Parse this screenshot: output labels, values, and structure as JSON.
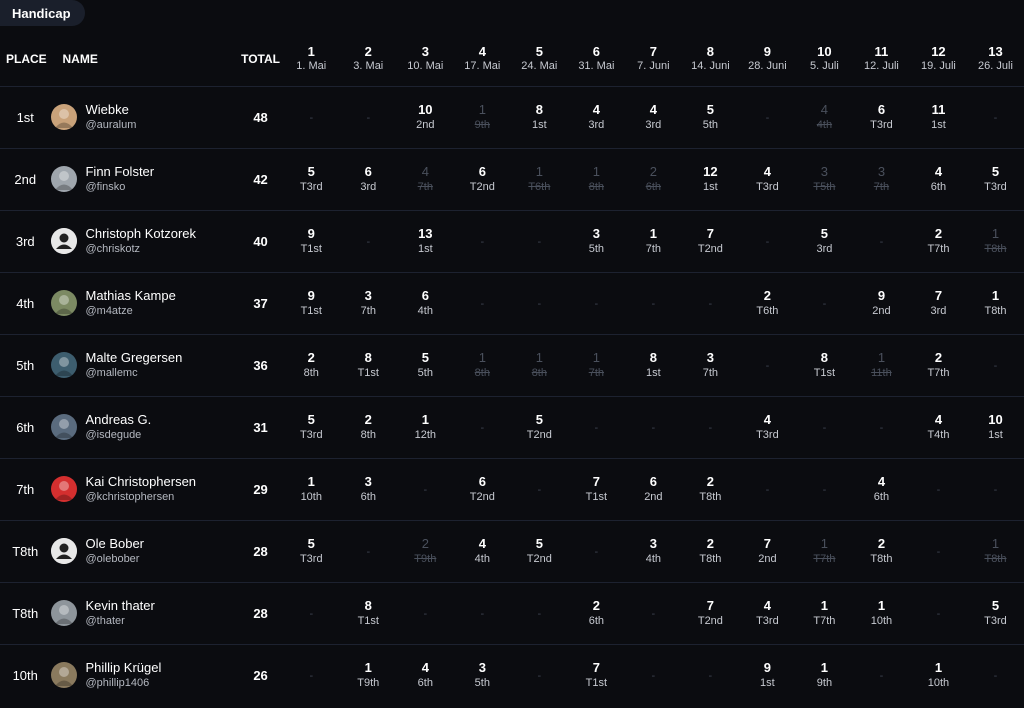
{
  "tab_label": "Handicap",
  "headers": {
    "place": "PLACE",
    "name": "NAME",
    "total": "TOTAL"
  },
  "events": [
    {
      "num": "1",
      "date": "1. Mai"
    },
    {
      "num": "2",
      "date": "3. Mai"
    },
    {
      "num": "3",
      "date": "10. Mai"
    },
    {
      "num": "4",
      "date": "17. Mai"
    },
    {
      "num": "5",
      "date": "24. Mai"
    },
    {
      "num": "6",
      "date": "31. Mai"
    },
    {
      "num": "7",
      "date": "7. Juni"
    },
    {
      "num": "8",
      "date": "14. Juni"
    },
    {
      "num": "9",
      "date": "28. Juni"
    },
    {
      "num": "10",
      "date": "5. Juli"
    },
    {
      "num": "11",
      "date": "12. Juli"
    },
    {
      "num": "12",
      "date": "19. Juli"
    },
    {
      "num": "13",
      "date": "26. Juli"
    }
  ],
  "dash": "-",
  "colors": {
    "background": "#0b0c10",
    "tab_bg": "#1a1f2b",
    "dropped": "#4a505c",
    "divider": "#1d2230"
  },
  "rows": [
    {
      "place": "1st",
      "name": "Wiebke",
      "handle": "@auralum",
      "total": "48",
      "avatar_icon": "avatar-photo-icon",
      "avatar_color": "#c9a27a",
      "results": [
        null,
        null,
        {
          "p": "10",
          "r": "2nd"
        },
        {
          "p": "1",
          "r": "9th",
          "d": true
        },
        {
          "p": "8",
          "r": "1st"
        },
        {
          "p": "4",
          "r": "3rd"
        },
        {
          "p": "4",
          "r": "3rd"
        },
        {
          "p": "5",
          "r": "5th"
        },
        null,
        {
          "p": "4",
          "r": "4th",
          "d": true
        },
        {
          "p": "6",
          "r": "T3rd"
        },
        {
          "p": "11",
          "r": "1st"
        },
        null
      ]
    },
    {
      "place": "2nd",
      "name": "Finn Folster",
      "handle": "@finsko",
      "total": "42",
      "avatar_icon": "avatar-photo-icon",
      "avatar_color": "#9fa6ad",
      "results": [
        {
          "p": "5",
          "r": "T3rd"
        },
        {
          "p": "6",
          "r": "3rd"
        },
        {
          "p": "4",
          "r": "7th",
          "d": true
        },
        {
          "p": "6",
          "r": "T2nd"
        },
        {
          "p": "1",
          "r": "T6th",
          "d": true
        },
        {
          "p": "1",
          "r": "8th",
          "d": true
        },
        {
          "p": "2",
          "r": "6th",
          "d": true
        },
        {
          "p": "12",
          "r": "1st"
        },
        {
          "p": "4",
          "r": "T3rd"
        },
        {
          "p": "3",
          "r": "T5th",
          "d": true
        },
        {
          "p": "3",
          "r": "7th",
          "d": true
        },
        {
          "p": "4",
          "r": "6th"
        },
        {
          "p": "5",
          "r": "T3rd"
        }
      ]
    },
    {
      "place": "3rd",
      "name": "Christoph Kotzorek",
      "handle": "@chriskotz",
      "total": "40",
      "avatar_icon": "default-user-icon",
      "avatar_color": "#e8e8e8",
      "results": [
        {
          "p": "9",
          "r": "T1st"
        },
        null,
        {
          "p": "13",
          "r": "1st"
        },
        null,
        null,
        {
          "p": "3",
          "r": "5th"
        },
        {
          "p": "1",
          "r": "7th"
        },
        {
          "p": "7",
          "r": "T2nd"
        },
        null,
        {
          "p": "5",
          "r": "3rd"
        },
        null,
        {
          "p": "2",
          "r": "T7th"
        },
        {
          "p": "1",
          "r": "T8th",
          "d": true
        }
      ]
    },
    {
      "place": "4th",
      "name": "Mathias Kampe",
      "handle": "@m4atze",
      "total": "37",
      "avatar_icon": "avatar-photo-icon",
      "avatar_color": "#7c8a63",
      "results": [
        {
          "p": "9",
          "r": "T1st"
        },
        {
          "p": "3",
          "r": "7th"
        },
        {
          "p": "6",
          "r": "4th"
        },
        null,
        null,
        null,
        null,
        null,
        {
          "p": "2",
          "r": "T6th"
        },
        null,
        {
          "p": "9",
          "r": "2nd"
        },
        {
          "p": "7",
          "r": "3rd"
        },
        {
          "p": "1",
          "r": "T8th"
        }
      ]
    },
    {
      "place": "5th",
      "name": "Malte Gregersen",
      "handle": "@mallemc",
      "total": "36",
      "avatar_icon": "avatar-photo-icon",
      "avatar_color": "#3d5d6e",
      "results": [
        {
          "p": "2",
          "r": "8th"
        },
        {
          "p": "8",
          "r": "T1st"
        },
        {
          "p": "5",
          "r": "5th"
        },
        {
          "p": "1",
          "r": "8th",
          "d": true
        },
        {
          "p": "1",
          "r": "8th",
          "d": true
        },
        {
          "p": "1",
          "r": "7th",
          "d": true
        },
        {
          "p": "8",
          "r": "1st"
        },
        {
          "p": "3",
          "r": "7th"
        },
        null,
        {
          "p": "8",
          "r": "T1st"
        },
        {
          "p": "1",
          "r": "11th",
          "d": true
        },
        {
          "p": "2",
          "r": "T7th"
        },
        null
      ]
    },
    {
      "place": "6th",
      "name": "Andreas G.",
      "handle": "@isdegude",
      "total": "31",
      "avatar_icon": "avatar-photo-icon",
      "avatar_color": "#5a6b7e",
      "results": [
        {
          "p": "5",
          "r": "T3rd"
        },
        {
          "p": "2",
          "r": "8th"
        },
        {
          "p": "1",
          "r": "12th"
        },
        null,
        {
          "p": "5",
          "r": "T2nd"
        },
        null,
        null,
        null,
        {
          "p": "4",
          "r": "T3rd"
        },
        null,
        null,
        {
          "p": "4",
          "r": "T4th"
        },
        {
          "p": "10",
          "r": "1st"
        }
      ]
    },
    {
      "place": "7th",
      "name": "Kai Christophersen",
      "handle": "@kchristophersen",
      "total": "29",
      "avatar_icon": "avatar-photo-icon",
      "avatar_color": "#d42f2f",
      "results": [
        {
          "p": "1",
          "r": "10th"
        },
        {
          "p": "3",
          "r": "6th"
        },
        null,
        {
          "p": "6",
          "r": "T2nd"
        },
        null,
        {
          "p": "7",
          "r": "T1st"
        },
        {
          "p": "6",
          "r": "2nd"
        },
        {
          "p": "2",
          "r": "T8th"
        },
        null,
        null,
        {
          "p": "4",
          "r": "6th"
        },
        null,
        null
      ]
    },
    {
      "place": "T8th",
      "name": "Ole Bober",
      "handle": "@olebober",
      "total": "28",
      "avatar_icon": "default-user-icon",
      "avatar_color": "#e8e8e8",
      "results": [
        {
          "p": "5",
          "r": "T3rd"
        },
        null,
        {
          "p": "2",
          "r": "T9th",
          "d": true
        },
        {
          "p": "4",
          "r": "4th"
        },
        {
          "p": "5",
          "r": "T2nd"
        },
        null,
        {
          "p": "3",
          "r": "4th"
        },
        {
          "p": "2",
          "r": "T8th"
        },
        {
          "p": "7",
          "r": "2nd"
        },
        {
          "p": "1",
          "r": "T7th",
          "d": true
        },
        {
          "p": "2",
          "r": "T8th"
        },
        null,
        {
          "p": "1",
          "r": "T8th",
          "d": true
        }
      ]
    },
    {
      "place": "T8th",
      "name": "Kevin thater",
      "handle": "@thater",
      "total": "28",
      "avatar_icon": "avatar-photo-icon",
      "avatar_color": "#8e959b",
      "results": [
        null,
        {
          "p": "8",
          "r": "T1st"
        },
        null,
        null,
        null,
        {
          "p": "2",
          "r": "6th"
        },
        null,
        {
          "p": "7",
          "r": "T2nd"
        },
        {
          "p": "4",
          "r": "T3rd"
        },
        {
          "p": "1",
          "r": "T7th"
        },
        {
          "p": "1",
          "r": "10th"
        },
        null,
        {
          "p": "5",
          "r": "T3rd"
        }
      ]
    },
    {
      "place": "10th",
      "name": "Phillip Krügel",
      "handle": "@phillip1406",
      "total": "26",
      "avatar_icon": "avatar-photo-icon",
      "avatar_color": "#8a7a5e",
      "results": [
        null,
        {
          "p": "1",
          "r": "T9th"
        },
        {
          "p": "4",
          "r": "6th"
        },
        {
          "p": "3",
          "r": "5th"
        },
        null,
        {
          "p": "7",
          "r": "T1st"
        },
        null,
        null,
        {
          "p": "9",
          "r": "1st"
        },
        {
          "p": "1",
          "r": "9th"
        },
        null,
        {
          "p": "1",
          "r": "10th"
        },
        null
      ]
    }
  ]
}
